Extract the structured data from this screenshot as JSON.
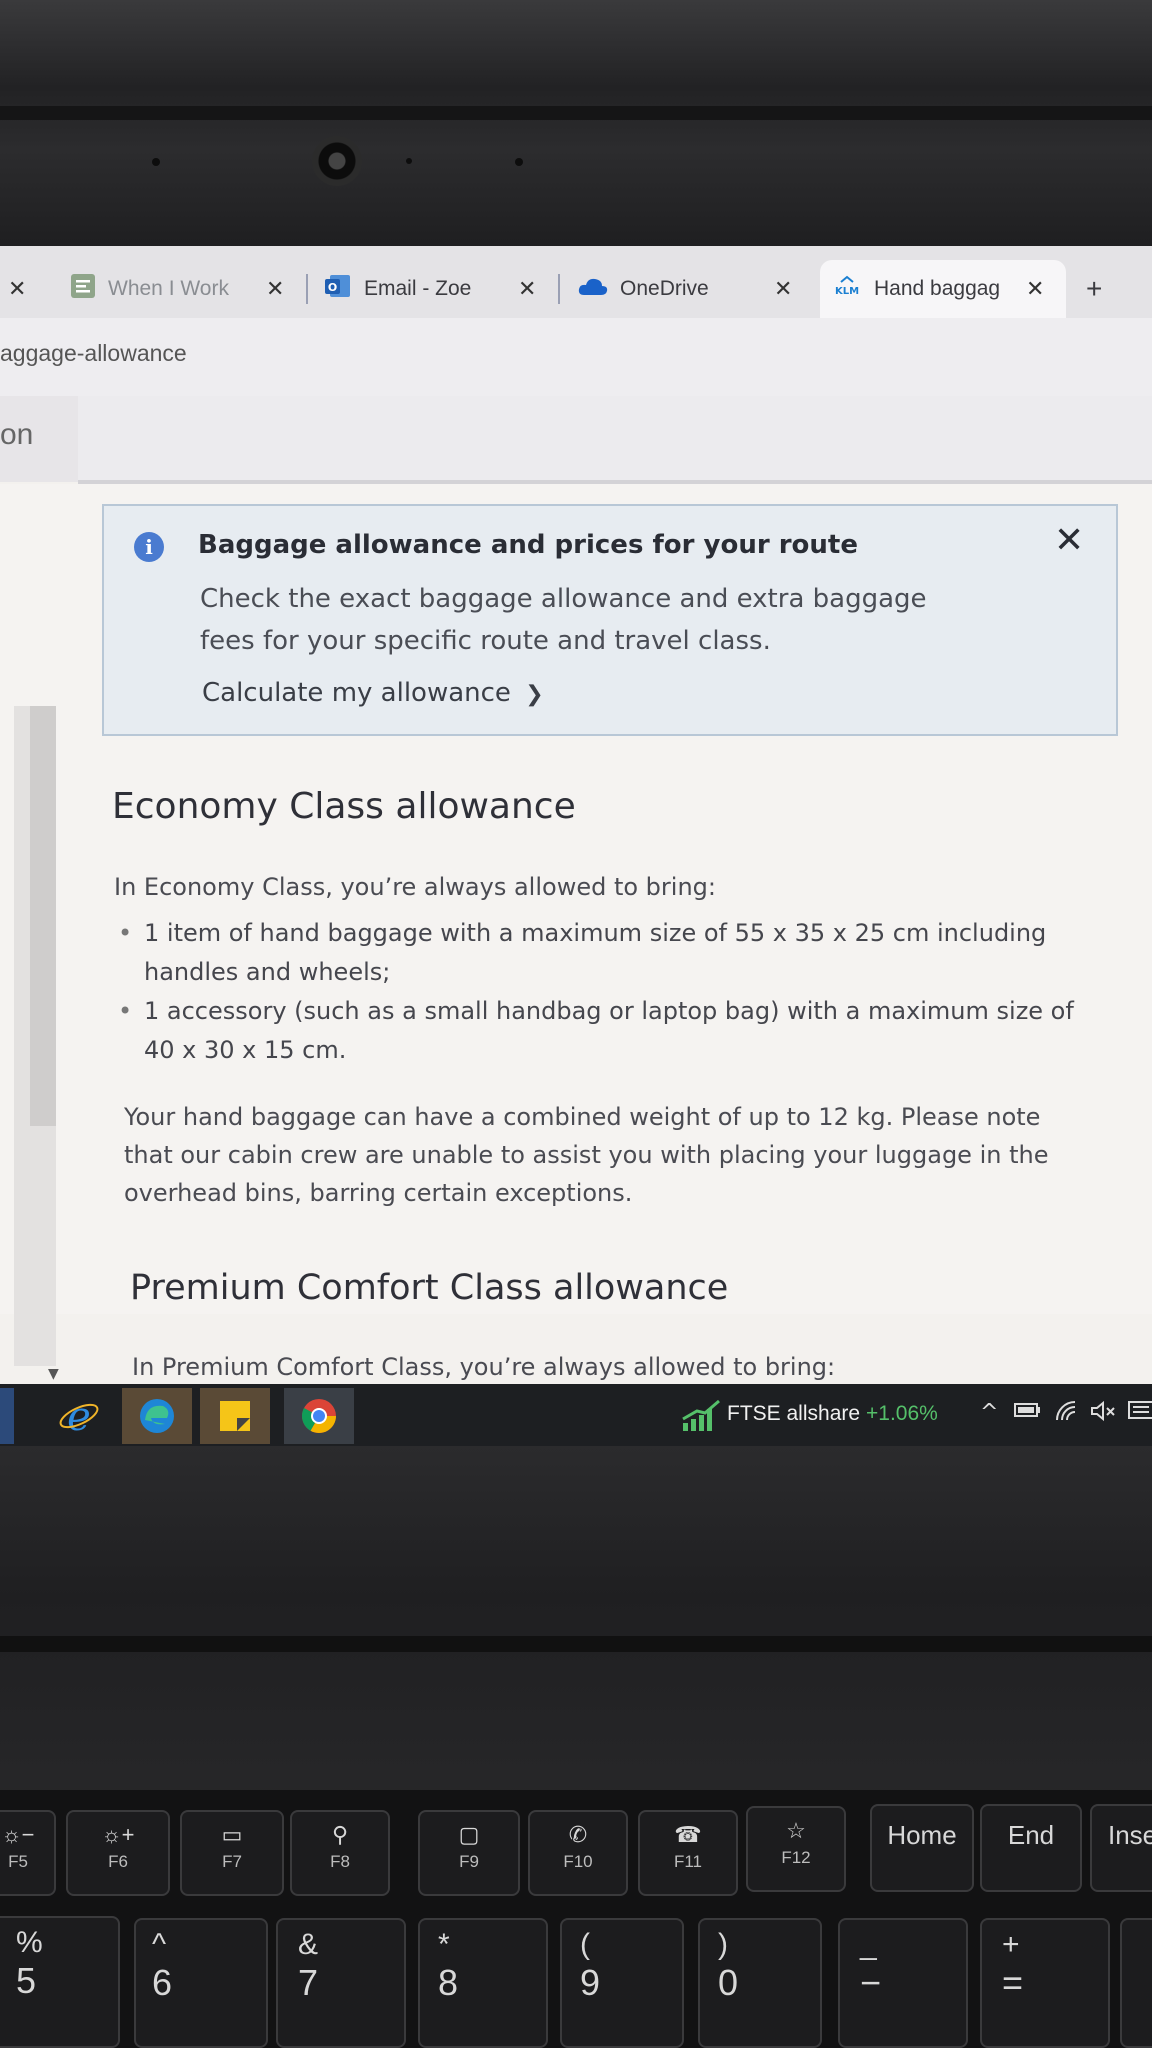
{
  "browser": {
    "tabs": [
      {
        "label": "",
        "closable": true
      },
      {
        "label": "When I Work",
        "icon": "when-i-work-icon",
        "closable": true
      },
      {
        "label": "Email - Zoe Sr",
        "icon": "outlook-icon",
        "closable": true
      },
      {
        "label": "OneDrive",
        "icon": "onedrive-icon",
        "closable": true
      },
      {
        "label": "Hand baggag",
        "icon": "klm-icon",
        "closable": true,
        "active": true
      }
    ],
    "new_tab": "+",
    "address": "aggage-allowance",
    "strip_text": "on"
  },
  "info_banner": {
    "title": "Baggage allowance and prices for your route",
    "body": "Check the exact baggage allowance and extra baggage fees for your specific route and travel class.",
    "link": "Calculate my allowance",
    "link_arrow": "❯",
    "close": "✕"
  },
  "economy": {
    "heading": "Economy Class allowance",
    "intro": "In Economy Class, you’re always allowed to bring:",
    "items": [
      "1 item of hand baggage with a maximum size of 55 x 35 x 25 cm including handles and wheels;",
      "1 accessory (such as a small handbag or laptop bag) with a maximum size of 40 x 30 x 15 cm."
    ],
    "note": "Your hand baggage can have a combined weight of up to 12 kg. Please note that our cabin crew are unable to assist you with placing your luggage in the overhead bins, barring certain exceptions."
  },
  "premium": {
    "heading": "Premium Comfort Class allowance",
    "intro": "In Premium Comfort Class, you’re always allowed to bring:"
  },
  "taskbar": {
    "apps": [
      "internet-explorer-icon",
      "edge-icon",
      "sticky-notes-icon",
      "chrome-icon"
    ],
    "ticker_name": "FTSE allshare",
    "ticker_change": "+1.06%",
    "tray_chevron": "^"
  },
  "keyboard": {
    "fn_keys": [
      {
        "top": "☼−",
        "bot": "F5"
      },
      {
        "top": "☼+",
        "bot": "F6"
      },
      {
        "top": "▭",
        "bot": "F7"
      },
      {
        "top": "⚲",
        "bot": "F8"
      },
      {
        "top": "▢",
        "bot": "F9"
      },
      {
        "top": "✆",
        "bot": "F10"
      },
      {
        "top": "☎",
        "bot": "F11"
      },
      {
        "top": "☆",
        "bot": "F12"
      },
      {
        "top": "Home",
        "bot": ""
      },
      {
        "top": "End",
        "bot": ""
      },
      {
        "top": "Inse",
        "bot": ""
      }
    ],
    "num_keys": [
      {
        "s1": "%",
        "s2": "5"
      },
      {
        "s1": "^",
        "s2": "6"
      },
      {
        "s1": "&",
        "s2": "7"
      },
      {
        "s1": "*",
        "s2": "8"
      },
      {
        "s1": "(",
        "s2": "9"
      },
      {
        "s1": ")",
        "s2": "0"
      },
      {
        "s1": "_",
        "s2": "−"
      },
      {
        "s1": "+",
        "s2": "="
      }
    ]
  },
  "colors": {
    "ticker_up": "#55c06a",
    "info_bg": "#e7ecf1",
    "info_icon": "#4a7bd0"
  }
}
